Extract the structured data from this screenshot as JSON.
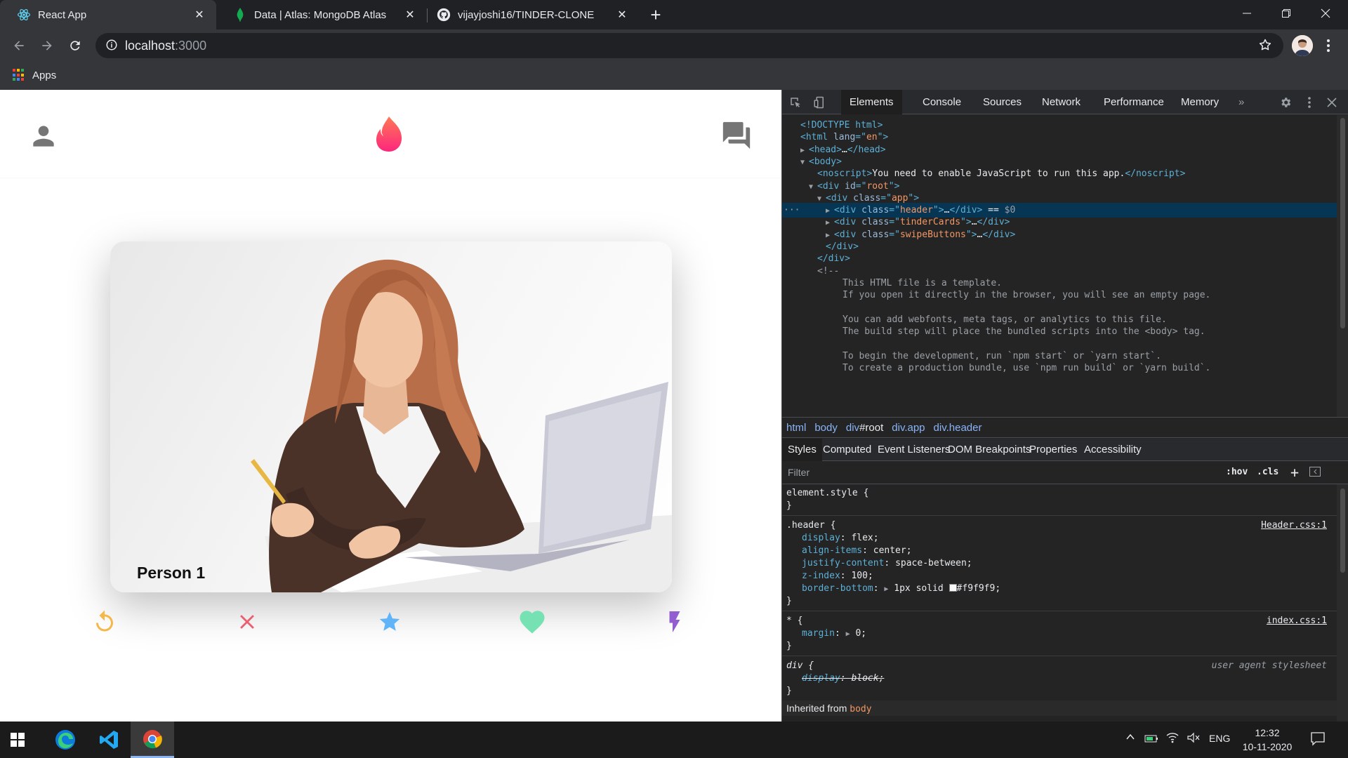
{
  "browser": {
    "tabs": [
      {
        "title": "React App",
        "icon": "react-icon",
        "active": true
      },
      {
        "title": "Data | Atlas: MongoDB Atlas",
        "icon": "mongodb-leaf-icon",
        "active": false
      },
      {
        "title": "vijayjoshi16/TINDER-CLONE",
        "icon": "github-icon",
        "active": false
      }
    ],
    "url_host": "localhost",
    "url_port": ":3000",
    "bookmarks": {
      "apps_label": "Apps"
    }
  },
  "app": {
    "card_name": "Person 1",
    "swipe_buttons": [
      {
        "name": "replay-icon",
        "color": "#f5b748"
      },
      {
        "name": "close-icon",
        "color": "#ec5e6f"
      },
      {
        "name": "star-icon",
        "color": "#62b4f9"
      },
      {
        "name": "favorite-icon",
        "color": "#76e2b3"
      },
      {
        "name": "flash-icon",
        "color": "#915dd1"
      }
    ],
    "brand_color": "#fe3c72"
  },
  "devtools": {
    "tabs": [
      "Elements",
      "Console",
      "Sources",
      "Network",
      "Performance",
      "Memory"
    ],
    "overflow": "»",
    "dom_lines": [
      {
        "d": 0,
        "t": "",
        "parts": [
          [
            "tg",
            "<!DOCTYPE html>"
          ]
        ]
      },
      {
        "d": 0,
        "t": "",
        "parts": [
          [
            "tg",
            "<html "
          ],
          [
            "an",
            "lang"
          ],
          [
            "tg",
            "=\""
          ],
          [
            "av",
            "en"
          ],
          [
            "tg",
            "\">"
          ]
        ]
      },
      {
        "d": 1,
        "t": "▶",
        "parts": [
          [
            "tg",
            "<head>"
          ],
          [
            "tx",
            "…"
          ],
          [
            "tg",
            "</head>"
          ]
        ]
      },
      {
        "d": 1,
        "t": "▼",
        "parts": [
          [
            "tg",
            "<body>"
          ]
        ]
      },
      {
        "d": 2,
        "t": "",
        "parts": [
          [
            "tg",
            "<noscript>"
          ],
          [
            "tx",
            "You need to enable JavaScript to run this app."
          ],
          [
            "tg",
            "</noscript>"
          ]
        ]
      },
      {
        "d": 2,
        "t": "▼",
        "parts": [
          [
            "tg",
            "<div "
          ],
          [
            "an",
            "id"
          ],
          [
            "tg",
            "=\""
          ],
          [
            "av",
            "root"
          ],
          [
            "tg",
            "\">"
          ]
        ]
      },
      {
        "d": 3,
        "t": "▼",
        "parts": [
          [
            "tg",
            "<div "
          ],
          [
            "an",
            "class"
          ],
          [
            "tg",
            "=\""
          ],
          [
            "av",
            "app"
          ],
          [
            "tg",
            "\">"
          ]
        ]
      },
      {
        "d": 4,
        "t": "▶",
        "sel": true,
        "parts": [
          [
            "tg",
            "<div "
          ],
          [
            "an",
            "class"
          ],
          [
            "tg",
            "=\""
          ],
          [
            "av",
            "header"
          ],
          [
            "tg",
            "\">"
          ],
          [
            "tx",
            "…"
          ],
          [
            "tg",
            "</div>"
          ],
          [
            "tx",
            " == "
          ],
          [
            "cm",
            "$0"
          ]
        ]
      },
      {
        "d": 4,
        "t": "▶",
        "parts": [
          [
            "tg",
            "<div "
          ],
          [
            "an",
            "class"
          ],
          [
            "tg",
            "=\""
          ],
          [
            "av",
            "tinderCards"
          ],
          [
            "tg",
            "\">"
          ],
          [
            "tx",
            "…"
          ],
          [
            "tg",
            "</div>"
          ]
        ]
      },
      {
        "d": 4,
        "t": "▶",
        "parts": [
          [
            "tg",
            "<div "
          ],
          [
            "an",
            "class"
          ],
          [
            "tg",
            "=\""
          ],
          [
            "av",
            "swipeButtons"
          ],
          [
            "tg",
            "\">"
          ],
          [
            "tx",
            "…"
          ],
          [
            "tg",
            "</div>"
          ]
        ]
      },
      {
        "d": 3,
        "t": "",
        "parts": [
          [
            "tg",
            "</div>"
          ]
        ]
      },
      {
        "d": 2,
        "t": "",
        "parts": [
          [
            "tg",
            "</div>"
          ]
        ]
      },
      {
        "d": 2,
        "t": "",
        "parts": [
          [
            "cm",
            "<!--"
          ]
        ]
      },
      {
        "d": 5,
        "t": "",
        "parts": [
          [
            "cm",
            "This HTML file is a template."
          ]
        ]
      },
      {
        "d": 5,
        "t": "",
        "parts": [
          [
            "cm",
            "If you open it directly in the browser, you will see an empty page."
          ]
        ]
      },
      {
        "d": 5,
        "t": "",
        "parts": [
          [
            "cm",
            ""
          ]
        ]
      },
      {
        "d": 5,
        "t": "",
        "parts": [
          [
            "cm",
            "You can add webfonts, meta tags, or analytics to this file."
          ]
        ]
      },
      {
        "d": 5,
        "t": "",
        "parts": [
          [
            "cm",
            "The build step will place the bundled scripts into the <body> tag."
          ]
        ]
      },
      {
        "d": 5,
        "t": "",
        "parts": [
          [
            "cm",
            ""
          ]
        ]
      },
      {
        "d": 5,
        "t": "",
        "parts": [
          [
            "cm",
            "To begin the development, run `npm start` or `yarn start`."
          ]
        ]
      },
      {
        "d": 5,
        "t": "",
        "parts": [
          [
            "cm",
            "To create a production bundle, use `npm run build` or `yarn build`."
          ]
        ]
      }
    ],
    "breadcrumbs": {
      "html": "html",
      "body": "body",
      "root_tag": "div",
      "root_id": "#root",
      "app": "div.app",
      "header": "div.header"
    },
    "subtabs": [
      "Styles",
      "Computed",
      "Event Listeners",
      "DOM Breakpoints",
      "Properties",
      "Accessibility"
    ],
    "filter_placeholder": "Filter",
    "hov": ":hov",
    "cls": ".cls",
    "styles": {
      "element_style": "element.style {",
      "close": "}",
      "header_selector": ".header {",
      "header_source": "Header.css:1",
      "header_props": [
        [
          "display",
          "flex;"
        ],
        [
          "align-items",
          "center;"
        ],
        [
          "justify-content",
          "space-between;"
        ],
        [
          "z-index",
          "100;"
        ]
      ],
      "border_prop": "border-bottom",
      "border_value_pre": "1px solid ",
      "border_value_color": "#f9f9f9;",
      "star_selector": "* {",
      "star_source": "index.css:1",
      "margin_prop": "margin",
      "margin_value": "0;",
      "div_selector": "div {",
      "div_source": "user agent stylesheet",
      "div_prop": "display",
      "div_value": "block;",
      "inherited_label": "Inherited from",
      "inherited_from": "body"
    }
  },
  "taskbar": {
    "time": "12:32",
    "date": "10-11-2020",
    "lang": "ENG"
  }
}
